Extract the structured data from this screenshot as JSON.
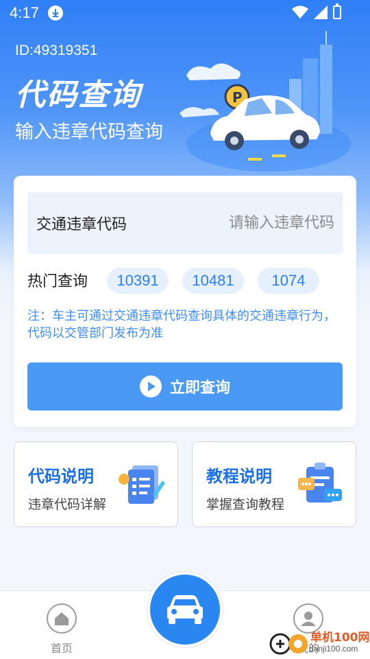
{
  "status_bar": {
    "time": "4:17"
  },
  "header": {
    "user_id": "ID:49319351",
    "title": "代码查询",
    "subtitle": "输入违章代码查询"
  },
  "query_card": {
    "code_label": "交通违章代码",
    "code_placeholder": "请输入违章代码",
    "code_value": "",
    "hot_label": "热门查询",
    "hot_codes": [
      "10391",
      "10481",
      "1074"
    ],
    "note": "注：车主可通过交通违章代码查询具体的交通违章行为，代码以交管部门发布为准",
    "submit_label": "立即查询"
  },
  "features": [
    {
      "title": "代码说明",
      "desc": "违章代码详解",
      "icon": "document-pen-icon"
    },
    {
      "title": "教程说明",
      "desc": "掌握查询教程",
      "icon": "clipboard-chat-icon"
    }
  ],
  "bottom_nav": {
    "home_label": "首页",
    "mine_label": "我的"
  },
  "watermark": {
    "text": "单机100网",
    "url": "danji100.com"
  },
  "colors": {
    "primary": "#2a86f0",
    "button": "#4a99f5",
    "note": "#3e8df5",
    "feature_title": "#1a6fe8"
  }
}
